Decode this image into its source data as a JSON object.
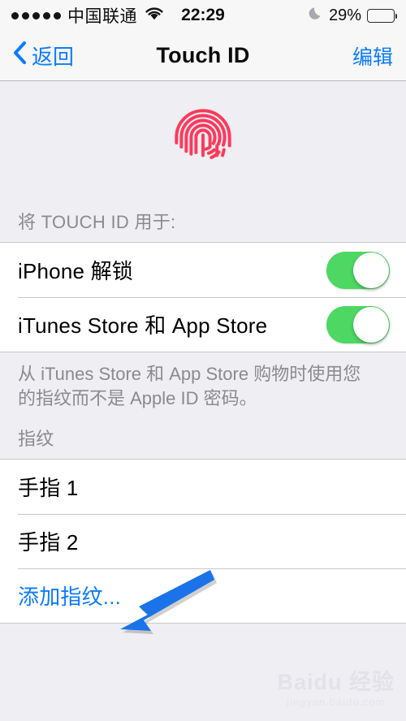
{
  "status_bar": {
    "signal_dots": 5,
    "carrier": "中国联通",
    "wifi_icon": "wifi-icon",
    "time": "22:29",
    "moon_icon": "moon-icon",
    "battery_percent": "29%",
    "battery_level": 29
  },
  "nav": {
    "back_label": "返回",
    "back_icon": "chevron-left-icon",
    "title": "Touch ID",
    "edit_label": "编辑"
  },
  "hero": {
    "icon": "fingerprint-icon",
    "icon_color": "#fb3b5c"
  },
  "sections": {
    "usage": {
      "header": "将 TOUCH ID 用于:",
      "rows": [
        {
          "label": "iPhone 解锁",
          "toggle": "on"
        },
        {
          "label": "iTunes Store 和 App Store",
          "toggle": "on"
        }
      ],
      "footer": "从 iTunes Store 和 App Store 购物时使用您的指纹而不是 Apple ID 密码。"
    },
    "fingerprints": {
      "header": "指纹",
      "rows": [
        {
          "label": "手指 1",
          "style": "normal"
        },
        {
          "label": "手指 2",
          "style": "normal"
        },
        {
          "label": "添加指纹...",
          "style": "link"
        }
      ]
    }
  },
  "annotation": {
    "arrow_color": "#1a73e8",
    "points_to": "添加指纹..."
  },
  "watermark": {
    "main": "Baidu 经验",
    "sub": "jingyan.baidu.com"
  },
  "colors": {
    "accent_blue": "#0b7bff",
    "toggle_green": "#4cd862",
    "fingerprint_pink": "#fb3b5c",
    "page_bg": "#efeef3",
    "bar_bg": "#f7f7f7"
  }
}
